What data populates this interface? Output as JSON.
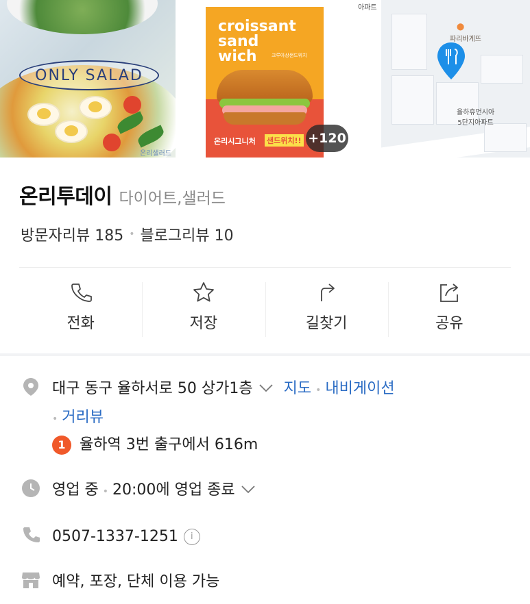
{
  "photos": {
    "photo1_badge": "ONLY SALAD",
    "photo1_watermark": "온리샐러드",
    "poster_title": "croissant\nsand\nwich",
    "poster_sub": "크루아상샌드위치",
    "poster_tag": "온리시그니처",
    "poster_tag2": "샌드위치!!",
    "more_count": "+120",
    "map_label_apt_top": "아파트",
    "map_label_bakery": "파리바게뜨",
    "map_label_apt_name": "율하휴먼시아\n5단지아파트"
  },
  "place": {
    "name": "온리투데이",
    "category": "다이어트,샐러드",
    "visitor_review": "방문자리뷰 185",
    "blog_review": "블로그리뷰 10"
  },
  "actions": [
    {
      "label": "전화",
      "icon": "phone-icon"
    },
    {
      "label": "저장",
      "icon": "star-icon"
    },
    {
      "label": "길찾기",
      "icon": "directions-icon"
    },
    {
      "label": "공유",
      "icon": "share-icon"
    }
  ],
  "details": {
    "address": "대구 동구 율하서로 50 상가1층",
    "map_link": "지도",
    "navigation_link": "내비게이션",
    "streetview_link": "거리뷰",
    "subway_number": "1",
    "subway_text": "율하역 3번 출구에서 616m",
    "status": "영업 중",
    "hours": "20:00에 영업 종료",
    "phone": "0507-1337-1251",
    "info_symbol": "i",
    "amenities": "예약, 포장, 단체 이용 가능"
  },
  "colors": {
    "link": "#2b6cc4",
    "pin": "#1d8fe8",
    "subway_badge": "#f0592a"
  }
}
